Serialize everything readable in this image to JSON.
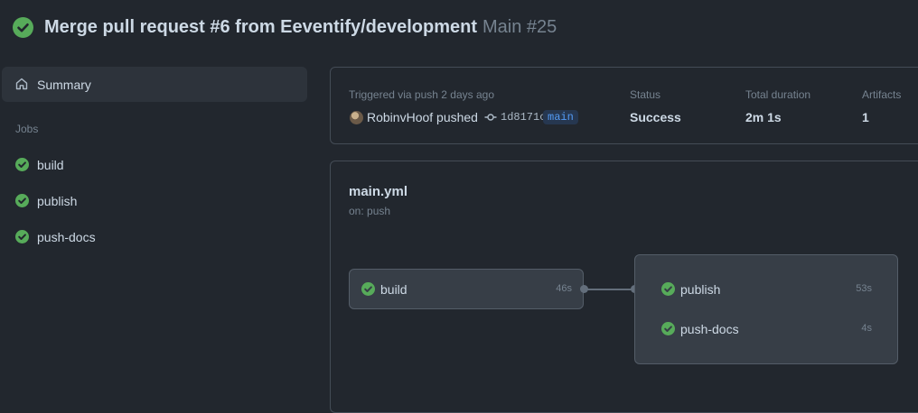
{
  "header": {
    "title": "Merge pull request #6 from Eeventify/development",
    "run_label": "Main #25"
  },
  "sidebar": {
    "summary_label": "Summary",
    "jobs_heading": "Jobs",
    "jobs": [
      {
        "label": "build"
      },
      {
        "label": "publish"
      },
      {
        "label": "push-docs"
      }
    ]
  },
  "run_info": {
    "trigger_text": "Triggered via push 2 days ago",
    "actor_text": "RobinvHoof pushed",
    "commit_sha": "1d8171c",
    "branch": "main",
    "status_label": "Status",
    "status_value": "Success",
    "duration_label": "Total duration",
    "duration_value": "2m 1s",
    "artifacts_label": "Artifacts",
    "artifacts_value": "1"
  },
  "workflow": {
    "file": "main.yml",
    "trigger": "on: push",
    "stage1": [
      {
        "name": "build",
        "duration": "46s"
      }
    ],
    "stage2": [
      {
        "name": "publish",
        "duration": "53s"
      },
      {
        "name": "push-docs",
        "duration": "4s"
      }
    ]
  },
  "colors": {
    "success": "#57ab5a",
    "background": "#22272e",
    "branch_text": "#539bf5"
  },
  "icons": {
    "status": "check-circle-icon",
    "summary": "home-icon",
    "commit": "git-commit-icon"
  }
}
